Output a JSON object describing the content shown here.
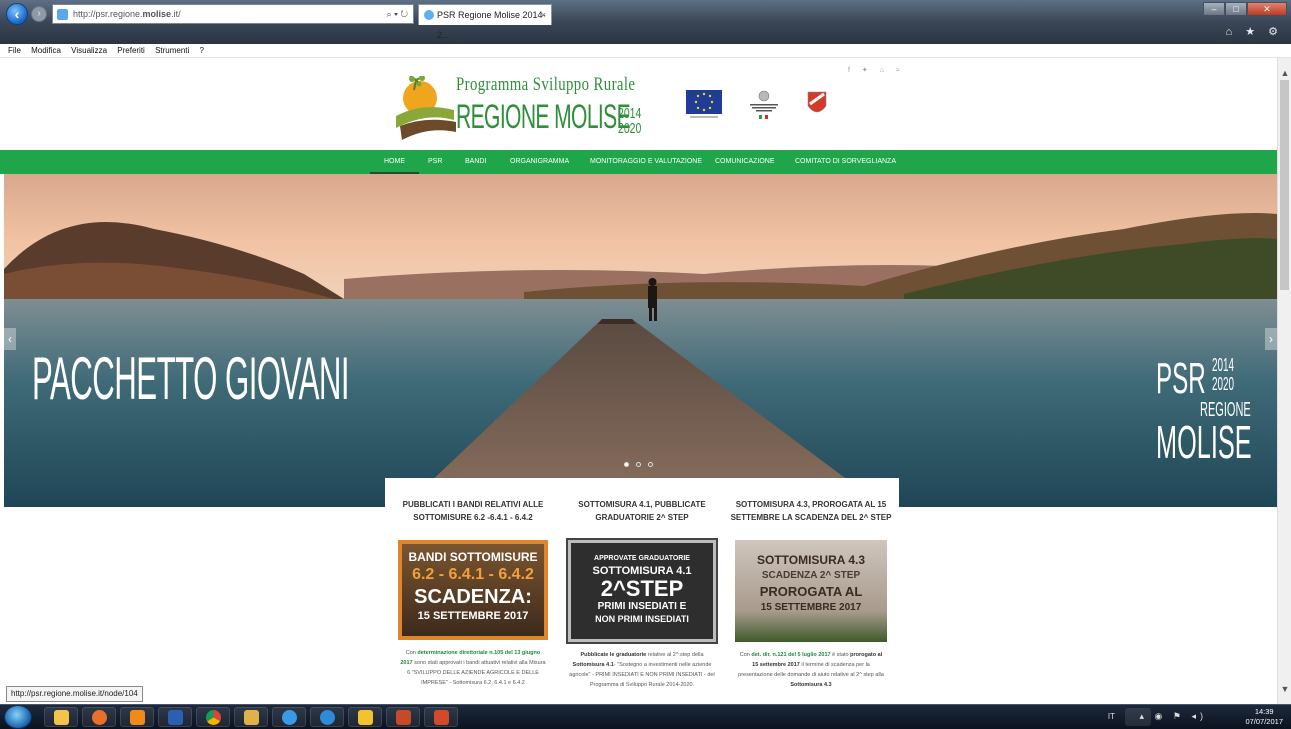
{
  "browser": {
    "address_prefix": "http://psr.regione.",
    "address_bold": "molise",
    "address_suffix": ".it/",
    "address_tools": "⌕ ▾ ↻",
    "tab_title": "PSR Regione Molise 2014-2...",
    "tab_close": "×",
    "menu": [
      "File",
      "Modifica",
      "Visualizza",
      "Preferiti",
      "Strumenti",
      "?"
    ],
    "toolbar_icons": "⌂ ★ ⚙",
    "status_url": "http://psr.regione.molise.it/node/104"
  },
  "site": {
    "logo_line1": "Programma Sviluppo Rurale",
    "logo_line2": "REGIONE MOLISE",
    "logo_year_top": "2014",
    "logo_year_bottom": "2020",
    "social": "f ✦ ⌂ ≈",
    "nav": [
      {
        "label": "HOME",
        "active": true
      },
      {
        "label": "PSR"
      },
      {
        "label": "BANDI"
      },
      {
        "label": "ORGANIGRAMMA"
      },
      {
        "label": "MONITORAGGIO E VALUTAZIONE"
      },
      {
        "label": "COMUNICAZIONE"
      },
      {
        "label": "COMITATO DI SORVEGLIANZA"
      }
    ],
    "colors": {
      "brand_green": "#1fa54a",
      "link_green": "#1f8a3c"
    }
  },
  "hero": {
    "left_title": "PACCHETTO GIOVANI",
    "right_psr": "PSR",
    "right_year_top": "2014",
    "right_year_bottom": "2020",
    "right_regione": "REGIONE",
    "right_molise": "MOLISE"
  },
  "news": [
    {
      "title": "PUBBLICATI I BANDI RELATIVI ALLE SOTTOMISURE 6.2 -6.4.1 - 6.4.2",
      "img_line1": "BANDI SOTTOMISURE",
      "img_line2": "6.2 - 6.4.1 - 6.4.2",
      "img_line3": "SCADENZA:",
      "img_line4": "15 SETTEMBRE 2017",
      "body_pre": "Con ",
      "body_link": "determinazione direttoriale n.105 del 13 giugno 2017",
      "body_post": " sono stati approvati i bandi attuativi relativi alla Misura 6 \"SVILUPPO DELLE AZIENDE AGRICOLE E DELLE IMPRESE\" - Sottomisura 6.2, 6.4.1 e 6.4.2"
    },
    {
      "title": "SOTTOMISURA 4.1, PUBBLICATE GRADUATORIE 2^ STEP",
      "img_line1": "APPROVATE GRADUATORIE",
      "img_line2": "SOTTOMISURA 4.1",
      "img_line3": "2^STEP",
      "img_line4": "PRIMI INSEDIATI E",
      "img_line5": "NON PRIMI INSEDIATI",
      "body_b1": "Pubblicate le graduatorie",
      "body_t1": " relative al 2^ step della ",
      "body_b2": "Sottomisura 4.1",
      "body_t2": "- \"Sostegno a investimenti nelle aziende agricole\" - PRIMI INSEDIATI E NON PRIMI INSEDIATI - del Programma di Sviluppo Rurale 2014-2020."
    },
    {
      "title": "SOTTOMISURA 4.3, PROROGATA AL 15 SETTEMBRE LA SCADENZA DEL 2^ STEP",
      "img_line1": "SOTTOMISURA 4.3",
      "img_line2": "SCADENZA 2^ STEP",
      "img_line3": "PROROGATA AL",
      "img_line4": "15 SETTEMBRE 2017",
      "body_pre": "Con ",
      "body_link": "det. dir. n.121 del 5 luglio 2017",
      "body_mid": " è stato ",
      "body_b": "prorogato al 15 settembre 2017",
      "body_post": " il termine di scadenza per la presentazione delle domande di aiuto relative al 2^ step alla ",
      "body_b2": "Sottomisura 4.3"
    }
  ],
  "taskbar": {
    "lang": "IT",
    "time": "14:39",
    "date": "07/07/2017"
  }
}
